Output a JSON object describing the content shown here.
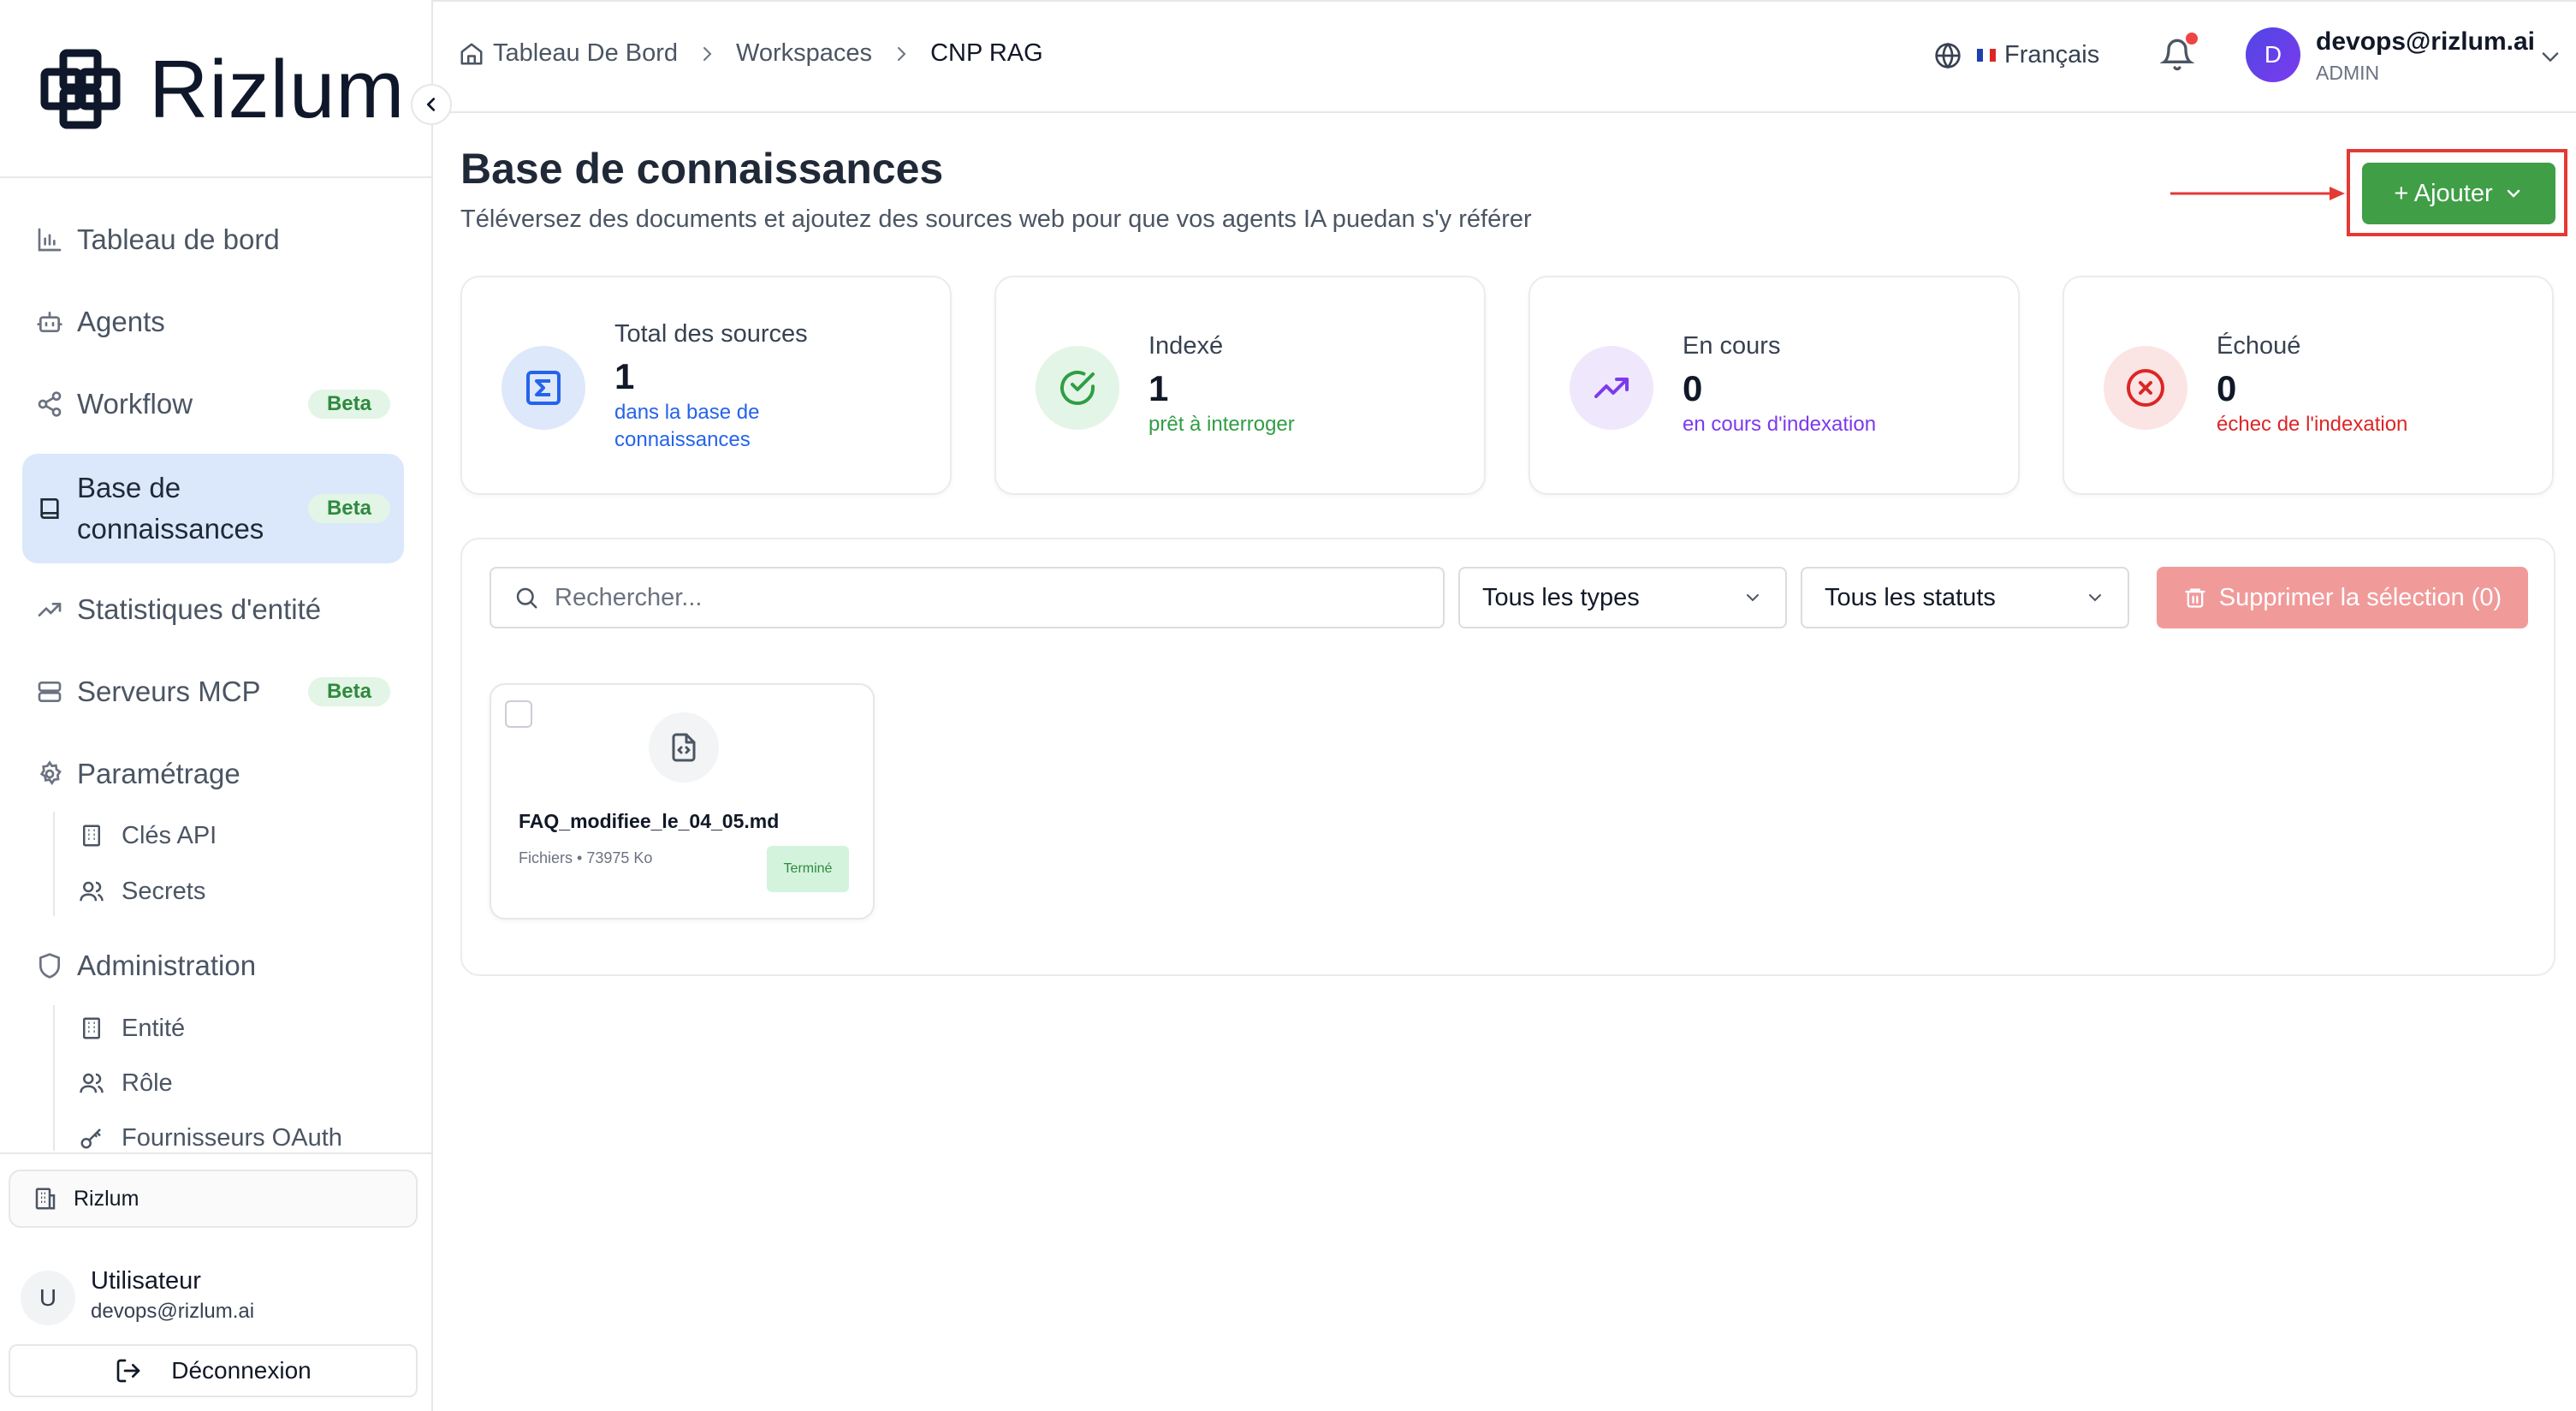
{
  "brand": {
    "name": "Rizlum"
  },
  "sidebar": {
    "items": [
      {
        "label": "Tableau de bord",
        "icon": "bar-chart-icon"
      },
      {
        "label": "Agents",
        "icon": "bot-icon"
      },
      {
        "label": "Workflow",
        "icon": "share-icon",
        "badge": "Beta"
      },
      {
        "label": "Base de connaissances",
        "icon": "book-icon",
        "badge": "Beta",
        "active": true
      },
      {
        "label": "Statistiques d'entité",
        "icon": "trending-up-icon"
      },
      {
        "label": "Serveurs MCP",
        "icon": "server-icon",
        "badge": "Beta"
      },
      {
        "label": "Paramétrage",
        "icon": "gear-icon"
      },
      {
        "label": "Administration",
        "icon": "shield-icon"
      }
    ],
    "settings_sub": [
      {
        "label": "Clés API",
        "icon": "building-icon"
      },
      {
        "label": "Secrets",
        "icon": "users-icon"
      }
    ],
    "admin_sub": [
      {
        "label": "Entité",
        "icon": "building-icon"
      },
      {
        "label": "Rôle",
        "icon": "users-icon"
      },
      {
        "label": "Fournisseurs OAuth",
        "icon": "key-icon"
      }
    ],
    "workspace": "Rizlum",
    "user": {
      "initial": "U",
      "name": "Utilisateur",
      "email": "devops@rizlum.ai"
    },
    "logout_label": "Déconnexion"
  },
  "header": {
    "breadcrumbs": [
      "Tableau De Bord",
      "Workspaces",
      "CNP RAG"
    ],
    "language": "Français",
    "user": {
      "initial": "D",
      "email": "devops@rizlum.ai",
      "role": "ADMIN"
    }
  },
  "page": {
    "title": "Base de connaissances",
    "subtitle": "Téléversez des documents et ajoutez des sources web pour que vos agents IA puedan s'y référer",
    "add_button": "+ Ajouter"
  },
  "stats": [
    {
      "label": "Total des sources",
      "value": "1",
      "caption": "dans la base de connaissances",
      "color": "#2563eb",
      "bg": "#dde8fb",
      "icon": "sigma-icon"
    },
    {
      "label": "Indexé",
      "value": "1",
      "caption": "prêt à interroger",
      "color": "#2f9e44",
      "bg": "#e3f5e6",
      "icon": "check-circle-icon"
    },
    {
      "label": "En cours",
      "value": "0",
      "caption": "en cours d'indexation",
      "color": "#7c3aed",
      "bg": "#efe7fb",
      "icon": "trending-up-icon"
    },
    {
      "label": "Échoué",
      "value": "0",
      "caption": "échec de l'indexation",
      "color": "#dc2626",
      "bg": "#fbe4e4",
      "icon": "x-circle-icon"
    }
  ],
  "filters": {
    "search_placeholder": "Rechercher...",
    "type_select": "Tous les types",
    "status_select": "Tous les statuts",
    "delete_button": "Supprimer la sélection (0)"
  },
  "files": [
    {
      "name": "FAQ_modifiee_le_04_05.md",
      "meta": "Fichiers • 73975 Ko",
      "status": "Terminé"
    }
  ],
  "colors": {
    "accent_green": "#3f9e46",
    "active_nav": "#dbe8fb",
    "danger": "#e53935"
  }
}
